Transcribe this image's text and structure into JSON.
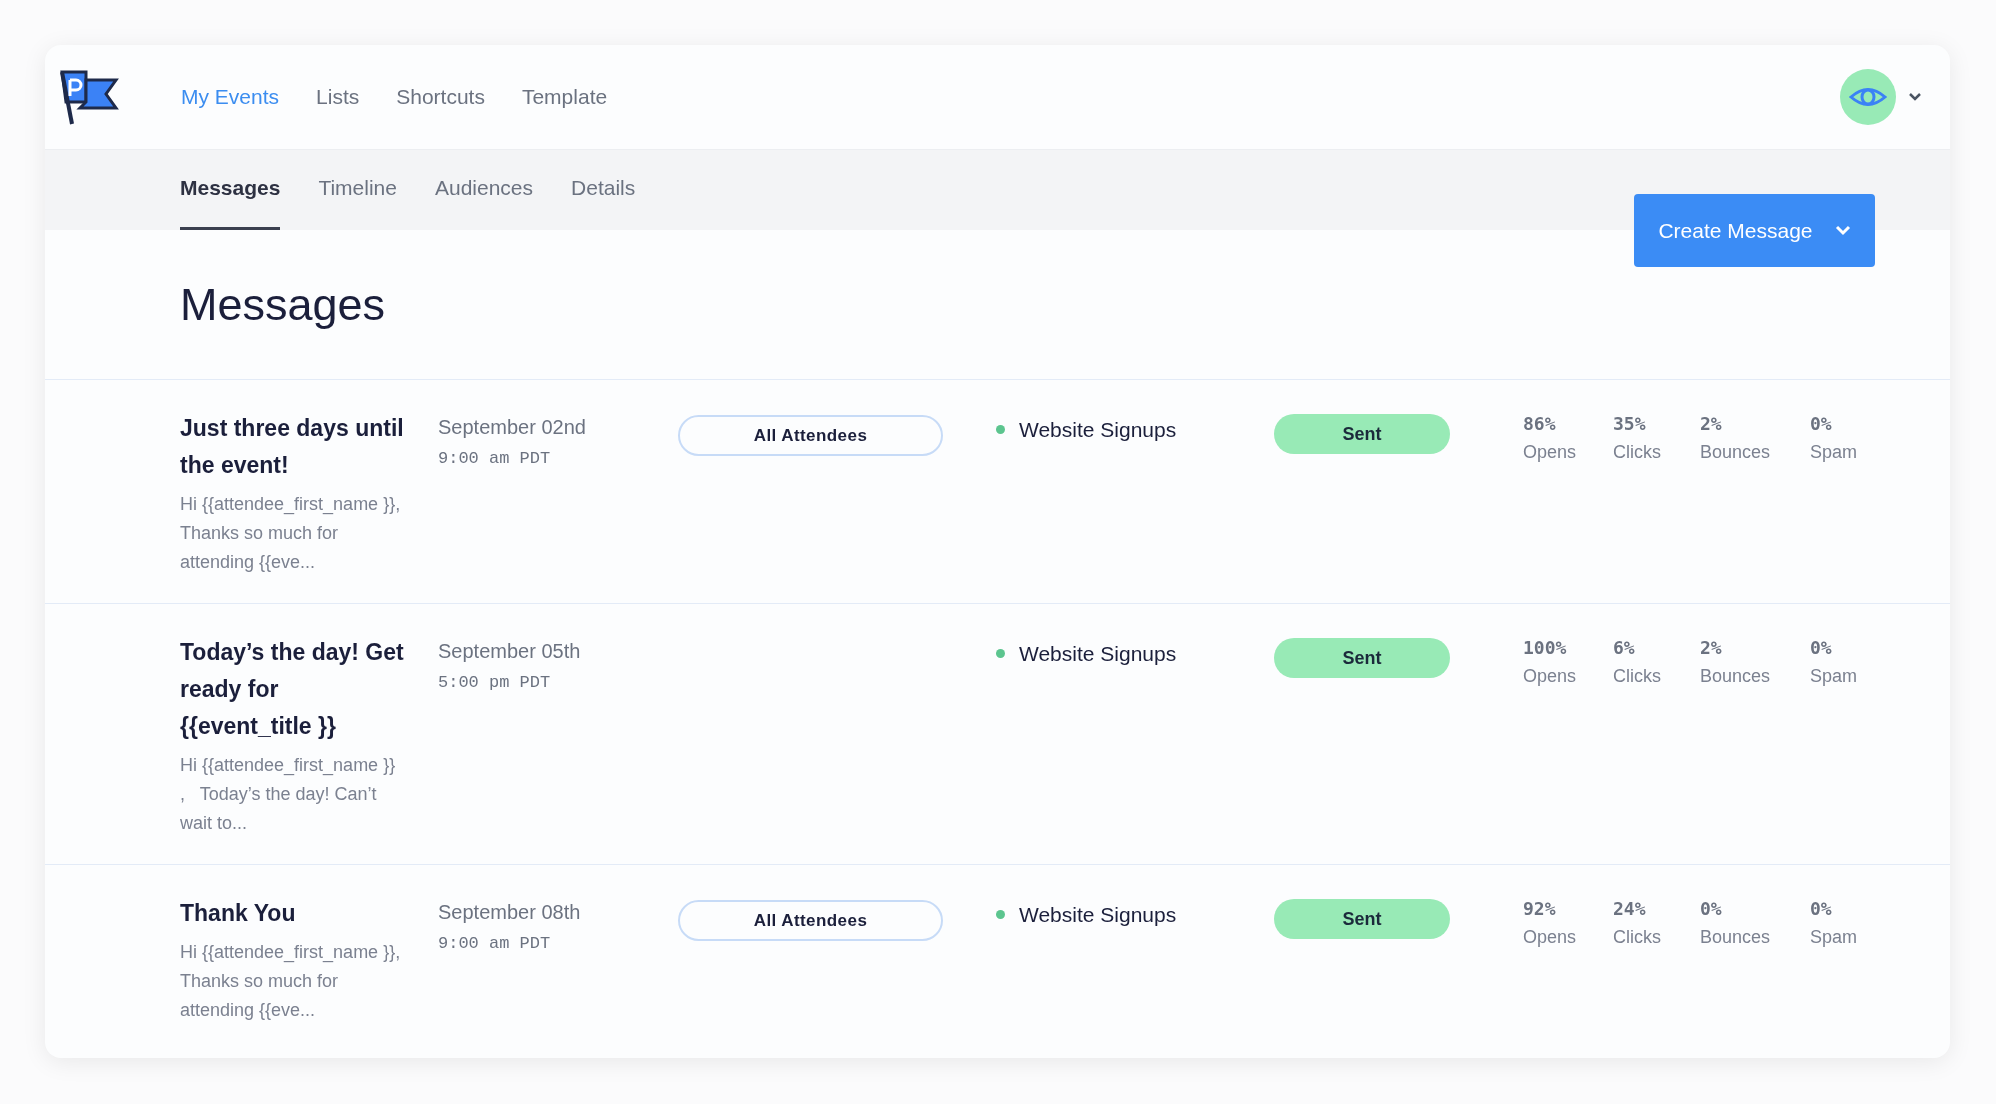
{
  "nav": [
    {
      "label": "My Events",
      "selected": true
    },
    {
      "label": "Lists",
      "selected": false
    },
    {
      "label": "Shortcuts",
      "selected": false
    },
    {
      "label": "Template",
      "selected": false
    }
  ],
  "tabs": [
    {
      "label": "Messages",
      "selected": true
    },
    {
      "label": "Timeline",
      "selected": false
    },
    {
      "label": "Audiences",
      "selected": false
    },
    {
      "label": "Details",
      "selected": false
    }
  ],
  "create_button": "Create Message",
  "page_title": "Messages",
  "messages": [
    {
      "title": "Just three days until the event!",
      "preview": "Hi {{attendee_first_name }},   Thanks so much for attending {{eve...",
      "date": "September 02nd",
      "time": "9:00 am PDT",
      "audience": "All Attendees",
      "list": "Website Signups",
      "status": "Sent",
      "stats": [
        {
          "value": "86%",
          "label": "Opens"
        },
        {
          "value": "35%",
          "label": "Clicks"
        },
        {
          "value": "2%",
          "label": "Bounces"
        },
        {
          "value": "0%",
          "label": "Spam"
        }
      ]
    },
    {
      "title": "Today’s the day! Get ready for {{event_title }}",
      "preview": "Hi {{attendee_first_name }} ,   Today’s the day! Can’t wait to...",
      "date": "September 05th",
      "time": "5:00 pm PDT",
      "list": "Website Signups",
      "status": "Sent",
      "stats": [
        {
          "value": "100%",
          "label": "Opens"
        },
        {
          "value": "6%",
          "label": "Clicks"
        },
        {
          "value": "2%",
          "label": "Bounces"
        },
        {
          "value": "0%",
          "label": "Spam"
        }
      ]
    },
    {
      "title": "Thank You",
      "preview": "Hi {{attendee_first_name }},   Thanks so much for attending {{eve...",
      "date": "September 08th",
      "time": "9:00 am PDT",
      "audience": "All Attendees",
      "list": "Website Signups",
      "status": "Sent",
      "stats": [
        {
          "value": "92%",
          "label": "Opens"
        },
        {
          "value": "24%",
          "label": "Clicks"
        },
        {
          "value": "0%",
          "label": "Bounces"
        },
        {
          "value": "0%",
          "label": "Spam"
        }
      ]
    }
  ]
}
